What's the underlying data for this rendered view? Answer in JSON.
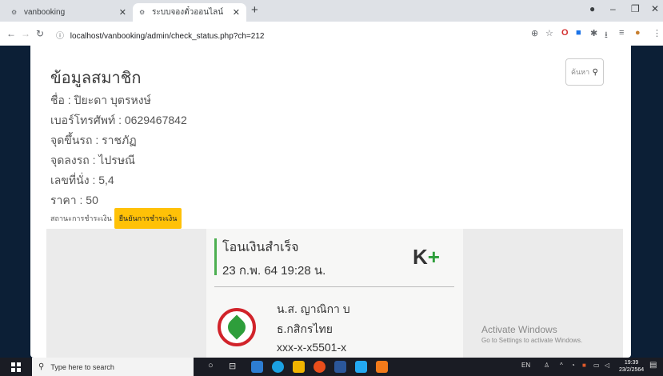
{
  "browser": {
    "tabs": [
      {
        "title": "vanbooking",
        "active": false
      },
      {
        "title": "ระบบจองตั๋วออนไลน์",
        "active": true
      }
    ],
    "url": "localhost/vanbooking/admin/check_status.php?ch=212"
  },
  "member": {
    "heading": "ข้อมูลสมาชิก",
    "name_line": "ชื่อ : ปิยะดา บุตรหงษ์",
    "phone_line": "เบอร์โทรศัพท์ : 0629467842",
    "pickup_line": "จุดขึ้นรถ : ราชภัฏ",
    "dropoff_line": "จุดลงรถ : ไปรษณี",
    "seat_line": "เลขที่นั่ง : 5,4",
    "price_line": "ราคา : 50",
    "status_label": "สถานะการชำระเงิน",
    "confirm_button": "ยืนยันการชำระเงิน"
  },
  "search": {
    "placeholder": "ค้นหา",
    "icon": "search-icon"
  },
  "slip": {
    "title": "โอนเงินสำเร็จ",
    "datetime": "23 ก.พ. 64 19:28 น.",
    "brand": "K",
    "brand_plus": "+",
    "name": "น.ส. ญาณิกา บ",
    "bank": "ธ.กสิกรไทย",
    "account": "xxx-x-x5501-x",
    "colors": {
      "accent": "#2e9e3b",
      "bank_red": "#d1232a"
    }
  },
  "watermark": {
    "line1": "Activate Windows",
    "line2": "Go to Settings to activate Windows."
  },
  "taskbar": {
    "search_placeholder": "Type here to search",
    "lang": "EN",
    "time": "19:39",
    "date": "23/2/2564"
  },
  "colors": {
    "page_bg": "#0c1f36",
    "button_yellow": "#ffc107"
  }
}
